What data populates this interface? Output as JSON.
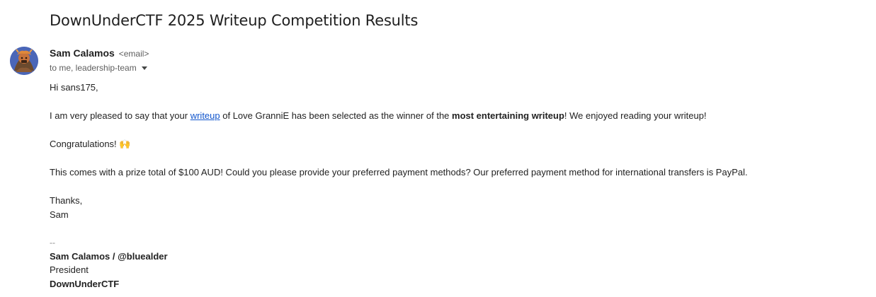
{
  "subject": "DownUnderCTF 2025 Writeup Competition Results",
  "sender": {
    "name": "Sam Calamos",
    "email": "<email>",
    "recipients": "to me, leadership-team"
  },
  "body": {
    "greeting": "Hi sans175,",
    "para1_pre": "I am very pleased to say that your ",
    "para1_link": "writeup",
    "para1_mid": " of Love GranniE has been selected as the winner of the ",
    "para1_bold": "most entertaining writeup",
    "para1_post": "! We enjoyed reading your writeup!",
    "congrats": "Congratulations! 🙌",
    "para2": "This comes with a prize total of $100 AUD! Could you please provide your preferred payment methods? Our preferred payment method for international transfers is PayPal.",
    "thanks": "Thanks,",
    "signoff": "Sam"
  },
  "signature": {
    "separator": "--",
    "name_handle": "Sam Calamos / @bluealder",
    "role": "President",
    "org": "DownUnderCTF"
  },
  "colors": {
    "link": "#1155cc",
    "text": "#222222",
    "muted": "#5e5e5e"
  },
  "icons": {
    "avatar": "sender-avatar",
    "recipients_toggle": "caret-down-icon"
  }
}
